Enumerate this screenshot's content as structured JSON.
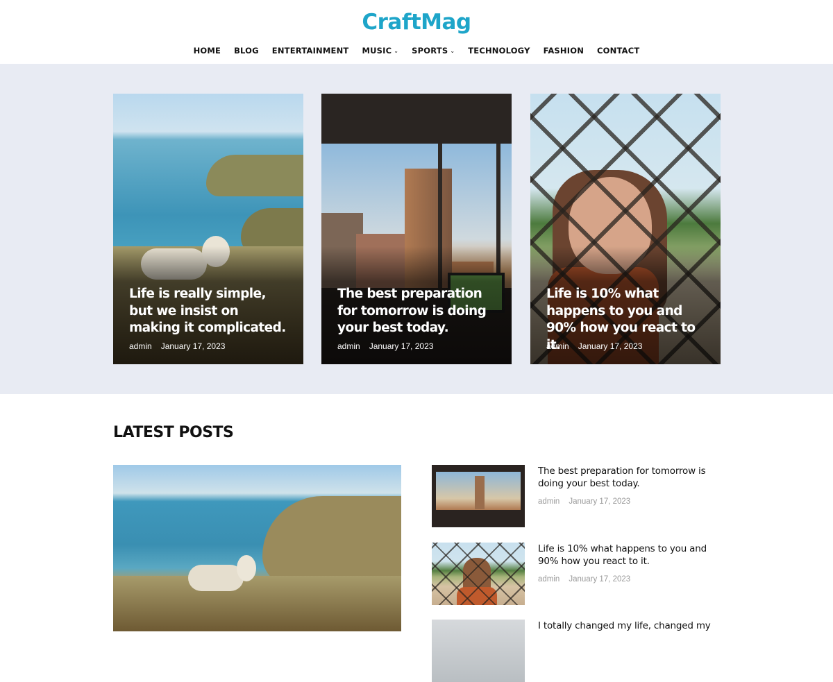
{
  "site": {
    "logo": "CraftMag",
    "accent": "#1ea5c9"
  },
  "nav": {
    "items": [
      {
        "label": "HOME"
      },
      {
        "label": "BLOG"
      },
      {
        "label": "ENTERTAINMENT"
      },
      {
        "label": "MUSIC",
        "dropdown": true
      },
      {
        "label": "SPORTS",
        "dropdown": true
      },
      {
        "label": "TECHNOLOGY"
      },
      {
        "label": "FASHION"
      },
      {
        "label": "CONTACT"
      }
    ],
    "chevron": "⌄"
  },
  "featured": [
    {
      "title": "Life is really simple, but we insist on making it complicated.",
      "author": "admin",
      "date": "January 17, 2023",
      "image": "coast-with-sheep"
    },
    {
      "title": "The best preparation for tomorrow is doing your best today.",
      "author": "admin",
      "date": "January 17, 2023",
      "image": "city-window-office"
    },
    {
      "title": "Life is 10% what happens to you and 90% how you react to it.",
      "author": "admin",
      "date": "January 17, 2023",
      "image": "woman-behind-fence"
    }
  ],
  "latest": {
    "heading": "LATEST POSTS",
    "main_image": "coast-with-sheep",
    "list": [
      {
        "title": "The best preparation for tomorrow is doing your best today.",
        "author": "admin",
        "date": "January 17, 2023",
        "image": "city-window-office"
      },
      {
        "title": "Life is 10% what happens to you and 90% how you react to it.",
        "author": "admin",
        "date": "January 17, 2023",
        "image": "woman-behind-fence"
      },
      {
        "title": "I totally changed my life, changed my",
        "author": "",
        "date": "",
        "image": "unknown"
      }
    ]
  }
}
